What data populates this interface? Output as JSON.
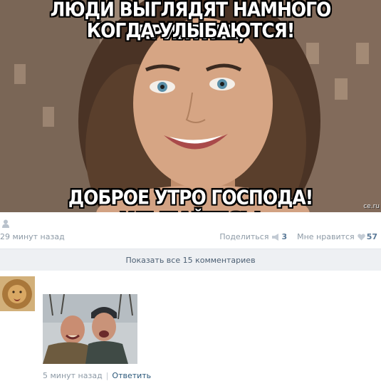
{
  "post": {
    "image": {
      "top_line_1": "ЛЮДИ ВЫГЛЯДЯТ НАМНОГО ПРИЯТНЕЕ,",
      "top_line_2": "КОГДА УЛЫБАЮТСЯ!",
      "bottom_line": "ДОБРОЕ УТРО ГОСПОДА! УЛЫБАЙТЕСЬ!",
      "watermark": "ce.ru"
    },
    "author_icon": "user-icon",
    "time_ago": "29 минут назад",
    "share_label": "Поделиться",
    "share_count": "3",
    "like_label": "Мне нравится",
    "like_count": "57"
  },
  "comments_bar": {
    "label": "Показать все 15 комментариев"
  },
  "comment": {
    "avatar": "lion-avatar",
    "photo": "two-men-photo",
    "time_ago": "5 минут назад",
    "separator": "|",
    "reply_label": "Ответить"
  },
  "colors": {
    "meta_text": "#8d9aa6",
    "link": "#2b587a",
    "bar_bg": "#eef0f3"
  }
}
